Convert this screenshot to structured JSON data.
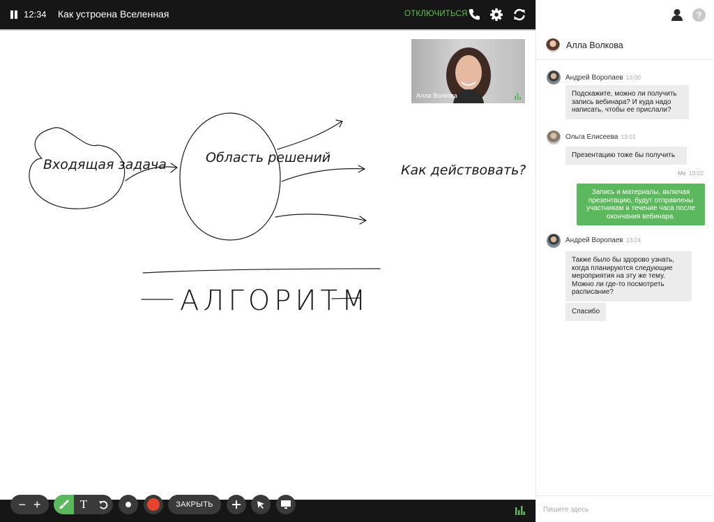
{
  "topbar": {
    "timer": "12:34",
    "title": "Как устроена Вселенная",
    "disconnect_label": "ОТКЛЮЧИТЬСЯ"
  },
  "board": {
    "handwriting": {
      "incoming_task": "Входящая задача",
      "solution_area": "Область решений",
      "how_to_act": "Как действовать?",
      "algorithm": "АЛГОРИТМ"
    }
  },
  "video": {
    "participant_name": "Алла Волкова"
  },
  "toolbar": {
    "close_label": "ЗАКРЫТЬ",
    "zoom_out": "−",
    "zoom_in": "+",
    "text_tool": "T"
  },
  "panel": {
    "header_name": "Алла Волкова",
    "input_placeholder": "Пишите здесь"
  },
  "chat": {
    "messages": [
      {
        "author": "Андрей Воропаев",
        "time": "13:00",
        "lines": [
          "Подскажите, можно ли получить",
          "запись вебинара? И куда надо",
          "написать, чтобы ее прислали?"
        ]
      },
      {
        "author": "Ольга Елисеева",
        "time": "13:01",
        "lines": [
          "Презентацию тоже бы получить"
        ]
      },
      {
        "author": "Me",
        "time": "13:02",
        "lines": [
          "Запись и материалы, включая",
          "презентацию, будут отправлены",
          "участникам в течение часа после",
          "окончания вебинара."
        ]
      },
      {
        "author": "Андрей Воропаев",
        "time": "13:24",
        "lines": [
          "Также было бы здорово узнать,",
          "когда планируются следующие",
          "мероприятия на эту же тему.",
          "Можно ли где-то посмотреть",
          "расписание?"
        ]
      },
      {
        "author": "Андрей Воропаев",
        "lines": [
          "Спасибо"
        ]
      }
    ]
  },
  "colors": {
    "accent_green": "#5cb85c",
    "topbar_bg": "#161616",
    "record_red": "#e8432f"
  }
}
